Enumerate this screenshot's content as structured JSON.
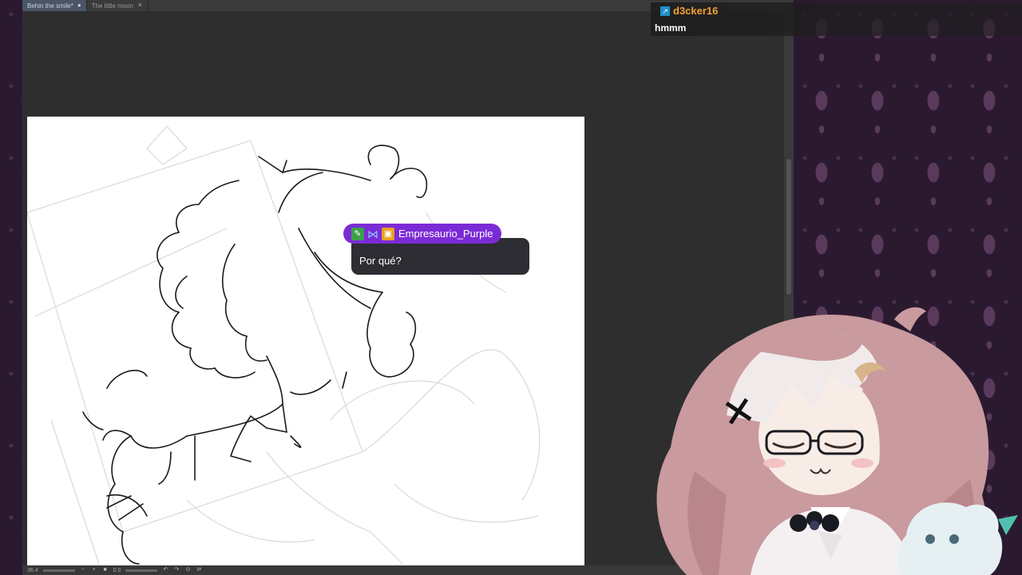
{
  "app": {
    "tabs": [
      {
        "label": "Behin the smile*",
        "mark": "●",
        "active": true
      },
      {
        "label": "The little moon",
        "mark": "✕",
        "active": false
      }
    ],
    "status": {
      "zoom": "36.4",
      "angle": "0.0"
    }
  },
  "chat_top": {
    "username": "d3cker16",
    "badge_icon": "broadcaster-arrow-icon",
    "message": "hmmm"
  },
  "chat_bubble": {
    "badges": [
      "sword-icon",
      "bow-icon",
      "gift-icon"
    ],
    "username": "Empresaurio_Purple",
    "message": "Por qué?"
  },
  "colors": {
    "username_top": "#f5a030",
    "bubble_name_bg": "#7b2bd6",
    "bubble_body_bg": "#2d2d33",
    "wallpaper": "#2b1a2f"
  }
}
